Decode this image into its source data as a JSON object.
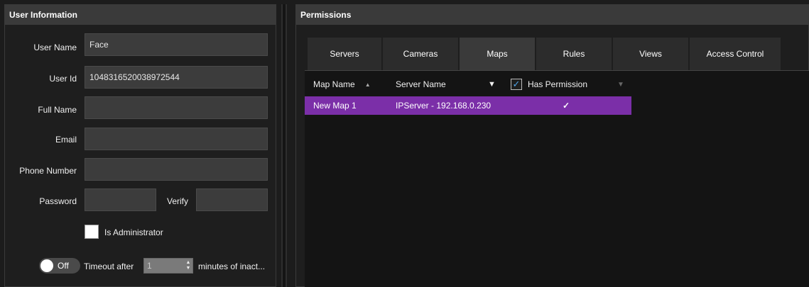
{
  "user_info": {
    "title": "User Information",
    "user_name_label": "User Name",
    "user_name_value": "Face",
    "user_id_label": "User Id",
    "user_id_value": "1048316520038972544",
    "full_name_label": "Full Name",
    "full_name_value": "",
    "email_label": "Email",
    "email_value": "",
    "phone_label": "Phone Number",
    "phone_value": "",
    "password_label": "Password",
    "password_value": "",
    "verify_label": "Verify",
    "verify_value": "",
    "is_admin_label": "Is Administrator",
    "is_admin_checked": false,
    "timeout_toggle_label": "Off",
    "timeout_prefix": "Timeout after",
    "timeout_value": "1",
    "timeout_suffix": "minutes of inact..."
  },
  "permissions": {
    "title": "Permissions",
    "tabs": [
      {
        "label": "Servers",
        "active": false
      },
      {
        "label": "Cameras",
        "active": false
      },
      {
        "label": "Maps",
        "active": true
      },
      {
        "label": "Rules",
        "active": false
      },
      {
        "label": "Views",
        "active": false
      },
      {
        "label": "Access Control",
        "active": false
      }
    ],
    "columns": {
      "map_name": "Map Name",
      "server_name": "Server Name",
      "has_permission": "Has Permission"
    },
    "rows": [
      {
        "map_name": "New Map 1",
        "server_name": "IPServer - 192.168.0.230",
        "has_permission": "✓"
      }
    ],
    "selected_row_color": "#7b2fa8"
  }
}
